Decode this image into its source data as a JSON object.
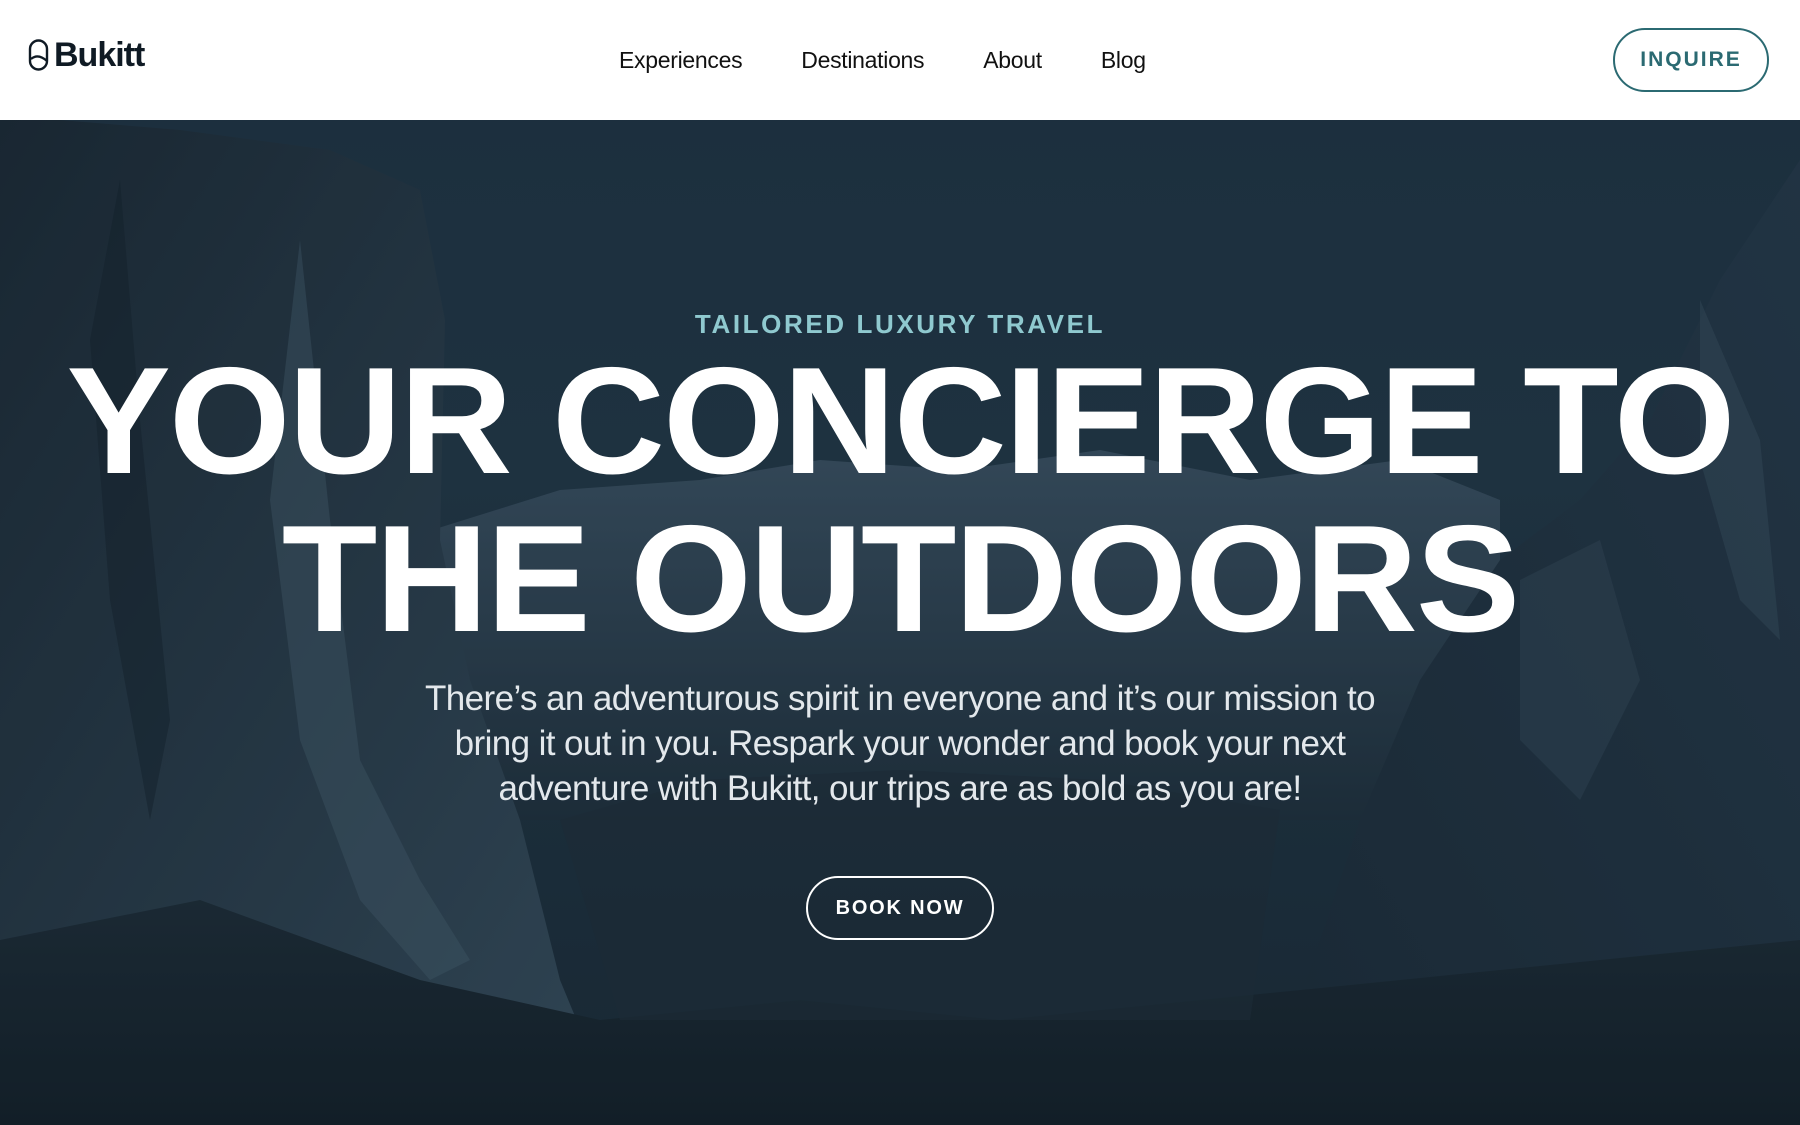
{
  "header": {
    "logo_text": "Bukitt",
    "logo_icon": "pill-leaf-logo-icon",
    "nav": [
      {
        "label": "Experiences"
      },
      {
        "label": "Destinations"
      },
      {
        "label": "About"
      },
      {
        "label": "Blog"
      }
    ],
    "inquire_label": "INQUIRE"
  },
  "hero": {
    "eyebrow": "TAILORED LUXURY TRAVEL",
    "headline_line1": "YOUR CONCIERGE TO",
    "headline_line2": "THE OUTDOORS",
    "subtext": "There’s an adventurous spirit in everyone and it’s our mission to bring it out in you. Respark your wonder and book your next adventure with Bukitt, our trips are as bold as you are!",
    "cta_label": "BOOK NOW"
  },
  "colors": {
    "accent_teal": "#2b6a72",
    "eyebrow_teal": "#8fc9cf",
    "hero_overlay": "#1c2d3a",
    "text_dark": "#111111"
  }
}
